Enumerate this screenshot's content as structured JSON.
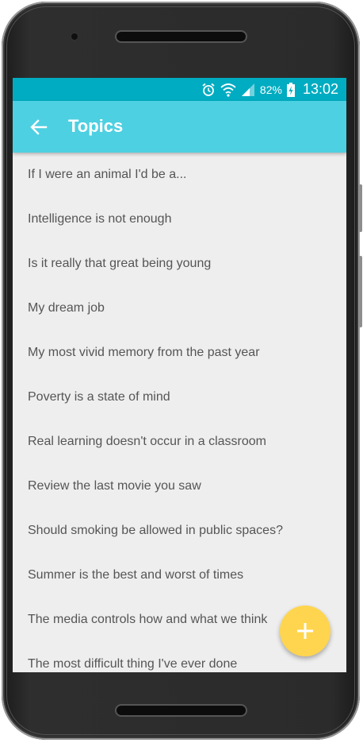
{
  "status_bar": {
    "battery_percent": "82%",
    "time": "13:02",
    "icons": [
      "alarm-icon",
      "wifi-icon",
      "signal-icon",
      "battery-charging-icon"
    ]
  },
  "app_bar": {
    "title": "Topics",
    "back_icon": "arrow-back-icon"
  },
  "topics": [
    "If I were an animal I'd be a...",
    "Intelligence is not enough",
    "Is it really that great being young",
    "My dream job",
    "My most vivid memory from the past year",
    "Poverty is a state of mind",
    "Real learning doesn't occur in a classroom",
    "Review the last movie you saw",
    "Should smoking be allowed in public spaces?",
    "Summer is the best and worst of times",
    "The media controls how and what we think",
    "The most difficult thing I've ever done"
  ],
  "fab": {
    "icon": "plus-icon"
  },
  "colors": {
    "status_bar": "#00acc1",
    "app_bar": "#4dd0e1",
    "fab": "#ffd54f",
    "list_background": "#eeeeee",
    "list_text": "#555555"
  }
}
